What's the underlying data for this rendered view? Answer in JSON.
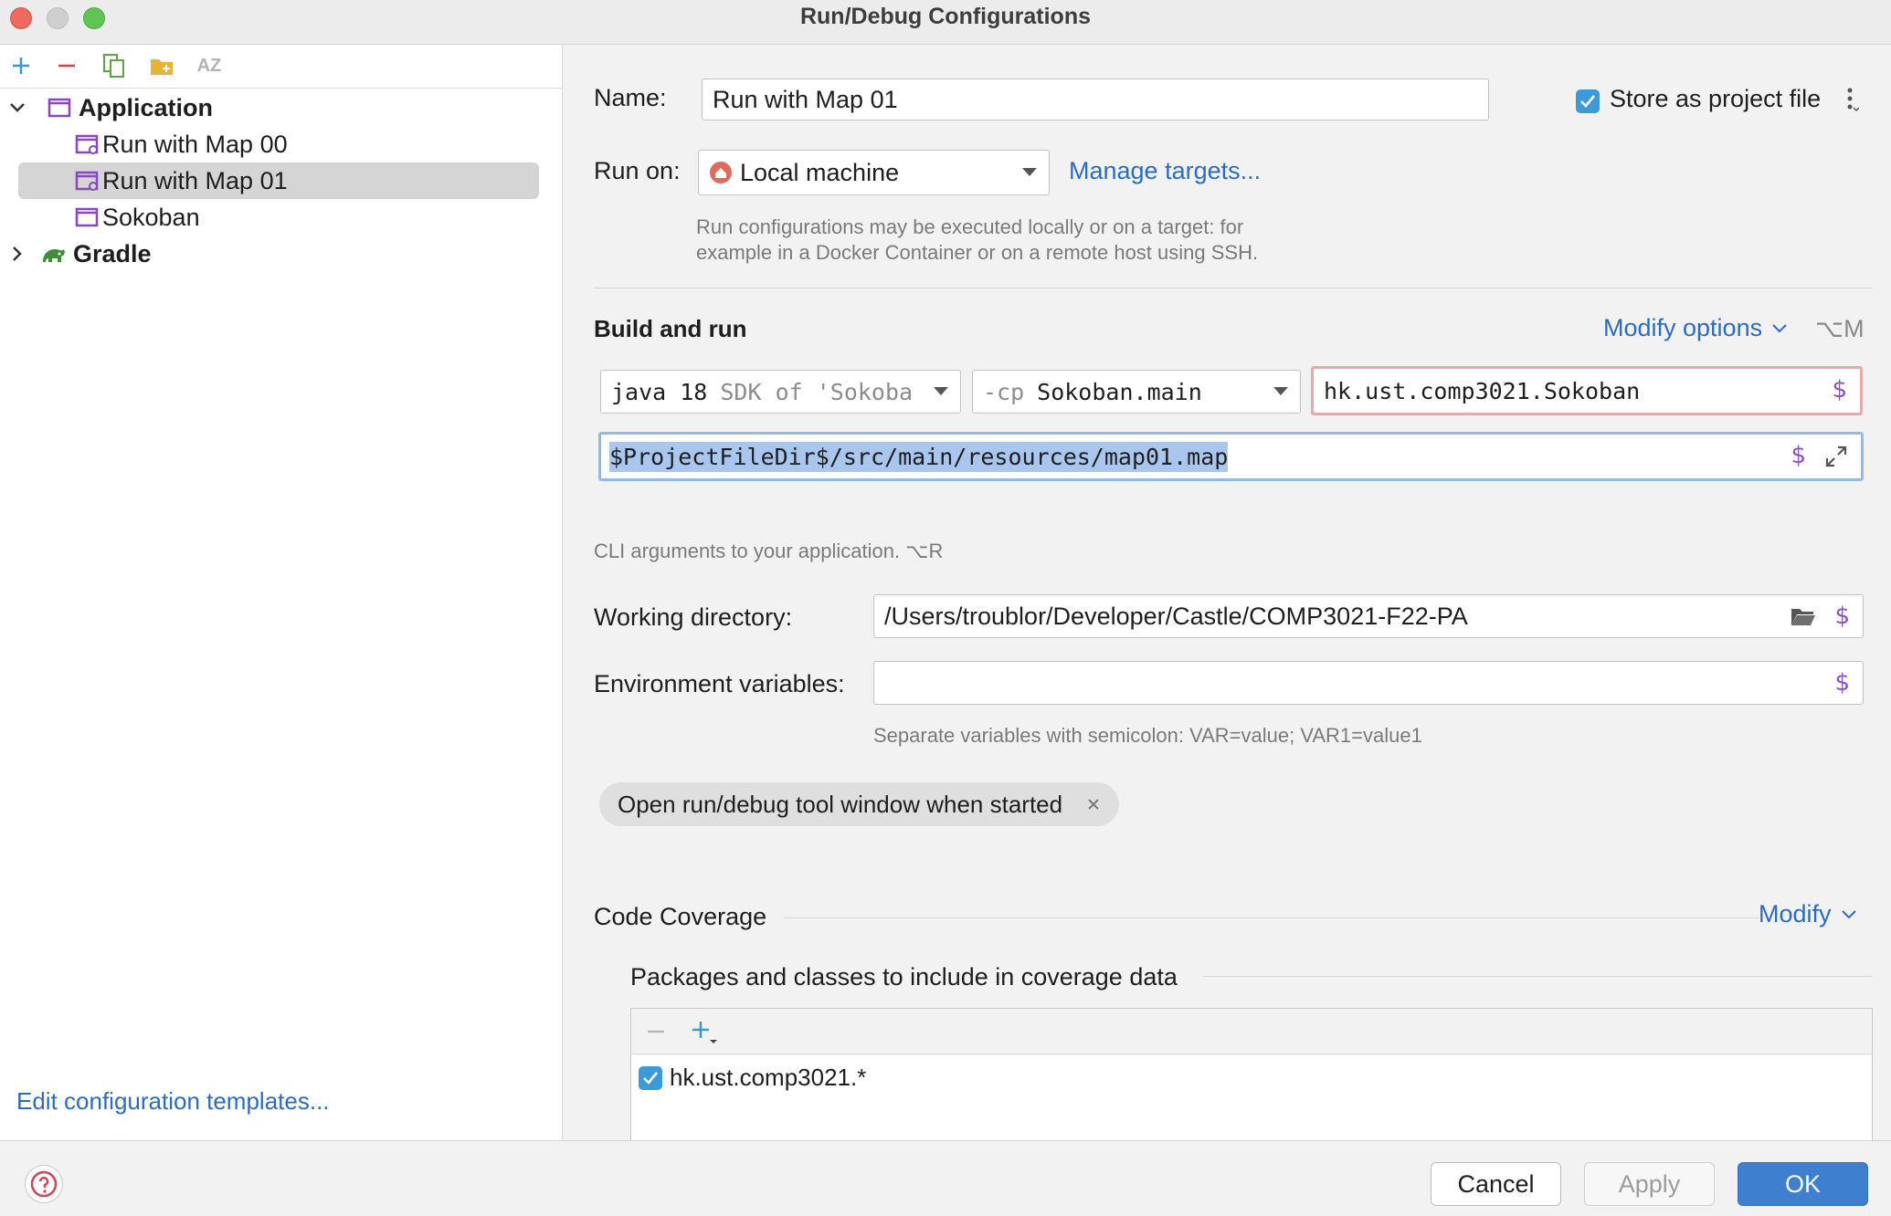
{
  "window": {
    "title": "Run/Debug Configurations"
  },
  "tree": {
    "application_label": "Application",
    "items": [
      "Run with Map 00",
      "Run with Map 01",
      "Sokoban"
    ],
    "gradle_label": "Gradle",
    "selected": "Run with Map 01"
  },
  "left_footer": {
    "edit_templates": "Edit configuration templates..."
  },
  "form": {
    "name_label": "Name:",
    "name_value": "Run with Map 01",
    "store_label": "Store as project file",
    "store_checked": true,
    "run_on_label": "Run on:",
    "run_on_value": "Local machine",
    "manage_targets": "Manage targets...",
    "run_on_hint_1": "Run configurations may be executed locally or on a target: for",
    "run_on_hint_2": "example in a Docker Container or on a remote host using SSH."
  },
  "build_run": {
    "title": "Build and run",
    "modify_options": "Modify options",
    "modify_shortcut": "⌥M",
    "jdk_main": "java 18",
    "jdk_suffix": "SDK of 'Sokoba",
    "cp_prefix": "-cp",
    "cp_value": "Sokoban.main",
    "main_class": "hk.ust.comp3021.Sokoban",
    "program_args": "$ProjectFileDir$/src/main/resources/map01.map",
    "args_hint": "CLI arguments to your application. ⌥R",
    "workdir_label": "Working directory:",
    "workdir_value": "/Users/troublor/Developer/Castle/COMP3021-F22-PA",
    "env_label": "Environment variables:",
    "env_value": "",
    "env_hint": "Separate variables with semicolon: VAR=value; VAR1=value1",
    "chip_label": "Open run/debug tool window when started"
  },
  "coverage": {
    "title": "Code Coverage",
    "modify": "Modify",
    "packages_title": "Packages and classes to include in coverage data",
    "entries": [
      {
        "pattern": "hk.ust.comp3021.*",
        "checked": true
      }
    ]
  },
  "buttons": {
    "cancel": "Cancel",
    "apply": "Apply",
    "ok": "OK"
  },
  "colors": {
    "accent": "#3e7fcf",
    "link": "#2a6cc4",
    "selection": "#a9c6ef",
    "error_border": "#e6aaaa",
    "macro": "#8a53c5"
  }
}
